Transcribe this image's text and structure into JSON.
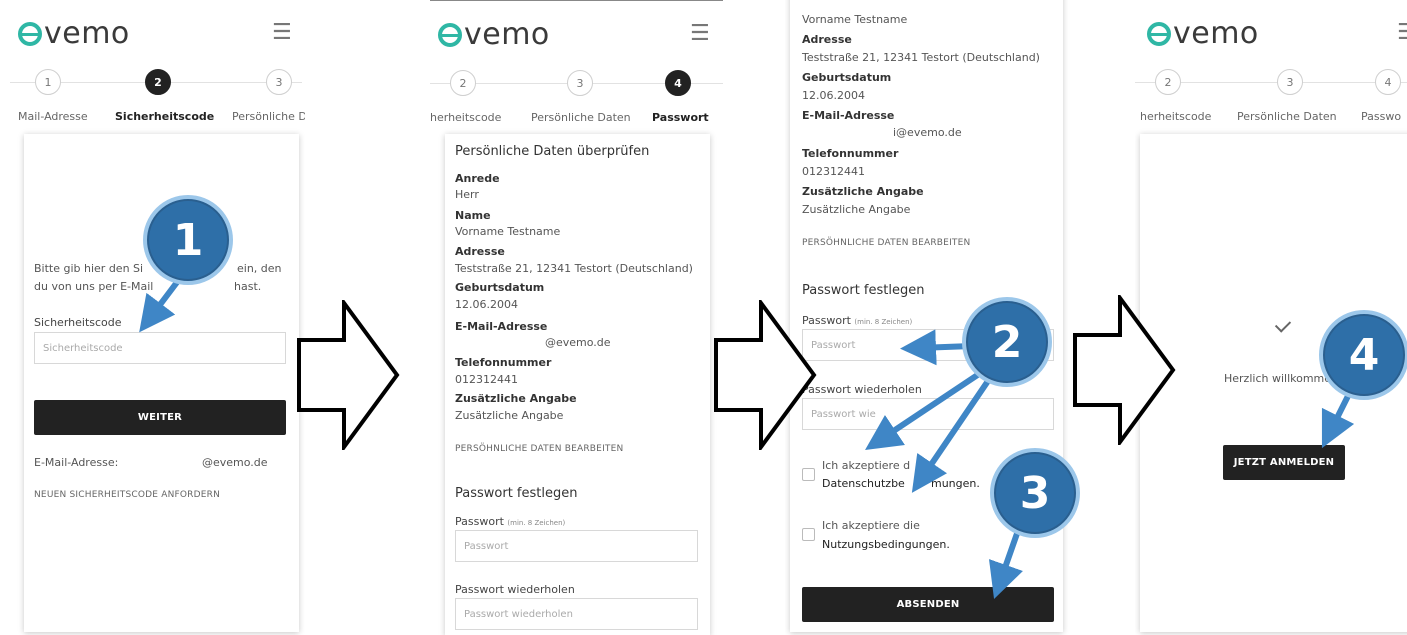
{
  "brand": {
    "name": "vemo",
    "accent": "#2fb7a5"
  },
  "colors": {
    "badge": "#2e6fa8",
    "badge_ring": "#9cc7ea",
    "button": "#222222"
  },
  "screen1": {
    "steps": [
      "1",
      "2",
      "3"
    ],
    "step_labels": [
      "Mail-Adresse",
      "Sicherheitscode",
      "Persönliche D"
    ],
    "instruction_line1": "Bitte gib hier den Si",
    "instruction_line1_end": "ein, den",
    "instruction_line2": "du von uns per E-Mail",
    "instruction_line2_end": "hast.",
    "code_label": "Sicherheitscode",
    "code_placeholder": "Sicherheitscode",
    "button": "WEITER",
    "email_label": "E-Mail-Adresse:",
    "email_value": "@evemo.de",
    "resend_link": "NEUEN SICHERHEITSCODE ANFORDERN"
  },
  "screen2": {
    "steps": [
      "2",
      "3",
      "4"
    ],
    "step_labels": [
      "herheitscode",
      "Persönliche Daten",
      "Passwort"
    ],
    "review_title": "Persönliche Daten überprüfen",
    "fields": [
      {
        "label": "Anrede",
        "value": "Herr"
      },
      {
        "label": "Name",
        "value": "Vorname Testname"
      },
      {
        "label": "Adresse",
        "value": "Teststraße 21, 12341 Testort (Deutschland)"
      },
      {
        "label": "Geburtsdatum",
        "value": "12.06.2004"
      },
      {
        "label": "E-Mail-Adresse",
        "value": "@evemo.de"
      },
      {
        "label": "Telefonnummer",
        "value": "012312441"
      },
      {
        "label": "Zusätzliche Angabe",
        "value": "Zusätzliche Angabe"
      }
    ],
    "edit_link": "PERSÖHNLICHE DATEN BEARBEITEN",
    "password_title": "Passwort festlegen",
    "password_label": "Passwort",
    "password_hint": "(min. 8 Zeichen)",
    "password_placeholder": "Passwort",
    "repeat_label": "Passwort wiederholen",
    "repeat_placeholder": "Passwort wiederholen"
  },
  "screen3": {
    "top_name": "Vorname Testname",
    "fields": [
      {
        "label": "Adresse",
        "value": "Teststraße 21, 12341 Testort (Deutschland)"
      },
      {
        "label": "Geburtsdatum",
        "value": "12.06.2004"
      },
      {
        "label": "E-Mail-Adresse",
        "value": "i@evemo.de"
      },
      {
        "label": "Telefonnummer",
        "value": "012312441"
      },
      {
        "label": "Zusätzliche Angabe",
        "value": "Zusätzliche Angabe"
      }
    ],
    "edit_link": "PERSÖHNLICHE DATEN BEARBEITEN",
    "password_title": "Passwort festlegen",
    "password_label": "Passwort",
    "password_hint": "(min. 8 Zeichen)",
    "password_placeholder": "Passwort",
    "repeat_label": "Passwort wiederholen",
    "repeat_placeholder": "Passwort wie",
    "privacy_line1": "Ich akzeptiere d",
    "privacy_line2": "Datenschutzbe",
    "privacy_line2_end": "mungen.",
    "terms_line1": "Ich akzeptiere die",
    "terms_line2": "Nutzungsbedingungen.",
    "button": "ABSENDEN"
  },
  "screen4": {
    "steps": [
      "2",
      "3",
      "4"
    ],
    "step_labels": [
      "herheitscode",
      "Persönliche Daten",
      "Passwo"
    ],
    "welcome": "Herzlich willkomme",
    "button": "JETZT ANMELDEN"
  },
  "badges": [
    "1",
    "2",
    "3",
    "4"
  ]
}
